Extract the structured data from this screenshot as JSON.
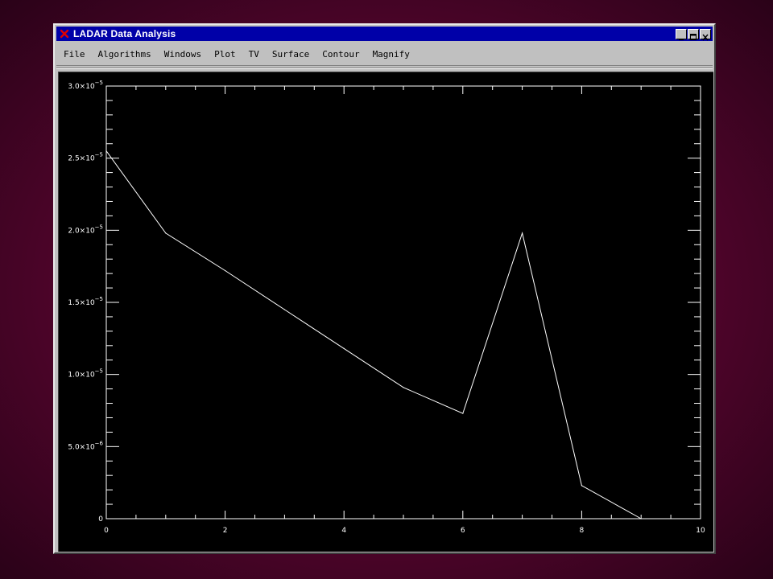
{
  "window": {
    "title": "LADAR Data Analysis",
    "close_icon": "red-x-icon",
    "controls": [
      "minimize-icon",
      "maximize-icon",
      "close-icon"
    ]
  },
  "menu": [
    {
      "label": "File"
    },
    {
      "label": "Algorithms"
    },
    {
      "label": "Windows"
    },
    {
      "label": "Plot"
    },
    {
      "label": "TV"
    },
    {
      "label": "Surface"
    },
    {
      "label": "Contour"
    },
    {
      "label": "Magnify"
    }
  ],
  "colors": {
    "plot_background": "#000000",
    "line": "#ffffff",
    "titlebar": "#0000a8",
    "desktop": "#5a0530"
  },
  "chart_data": {
    "type": "line",
    "x": [
      0,
      1,
      2,
      3,
      4,
      5,
      6,
      7,
      8,
      9
    ],
    "series": [
      {
        "values": [
          2.55e-05,
          1.98e-05,
          1.72e-05,
          1.45e-05,
          1.18e-05,
          9.1e-06,
          7.3e-06,
          1.98e-05,
          2.3e-06,
          0
        ]
      }
    ],
    "xlim": [
      0,
      10
    ],
    "ylim": [
      0,
      3e-05
    ],
    "xticks": [
      {
        "value": 0,
        "label": "0"
      },
      {
        "value": 2,
        "label": "2"
      },
      {
        "value": 4,
        "label": "4"
      },
      {
        "value": 6,
        "label": "6"
      },
      {
        "value": 8,
        "label": "8"
      },
      {
        "value": 10,
        "label": "10"
      }
    ],
    "yticks": [
      {
        "value": 0,
        "label": "0",
        "exp": ""
      },
      {
        "value": 5e-06,
        "label": "5.0×10",
        "exp": "−6"
      },
      {
        "value": 1e-05,
        "label": "1.0×10",
        "exp": "−5"
      },
      {
        "value": 1.5e-05,
        "label": "1.5×10",
        "exp": "−5"
      },
      {
        "value": 2e-05,
        "label": "2.0×10",
        "exp": "−5"
      },
      {
        "value": 2.5e-05,
        "label": "2.5×10",
        "exp": "−5"
      },
      {
        "value": 3e-05,
        "label": "3.0×10",
        "exp": "−5"
      }
    ],
    "title": "",
    "xlabel": "",
    "ylabel": "",
    "grid": false
  }
}
